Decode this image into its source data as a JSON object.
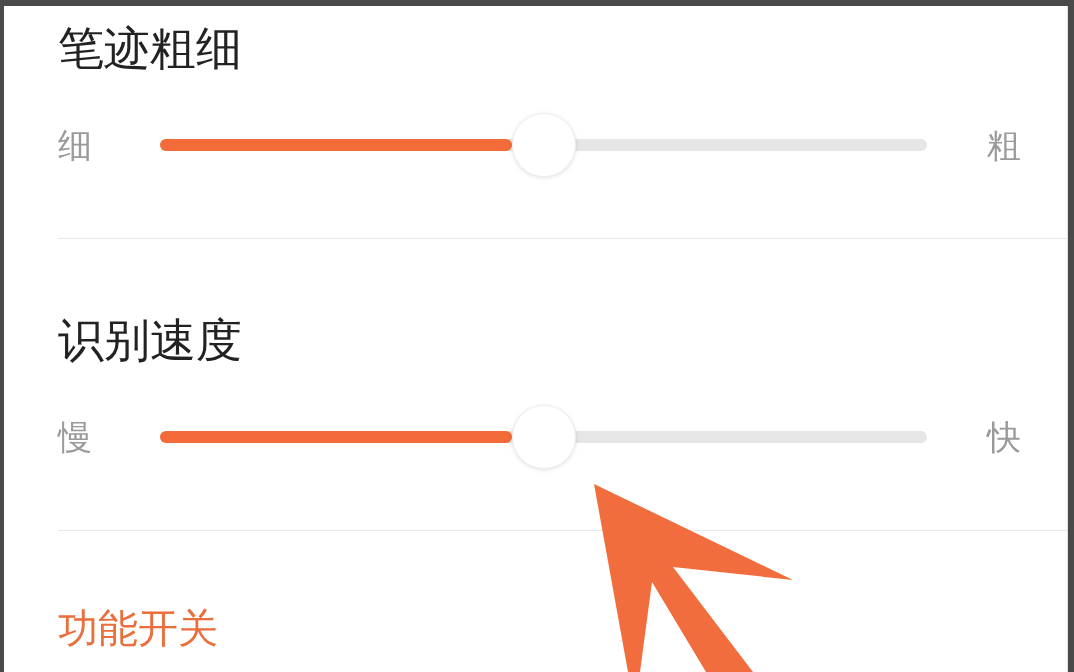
{
  "sections": [
    {
      "kind": "slider",
      "title": "笔迹粗细",
      "min_label": "细",
      "max_label": "粗",
      "level": 0.5
    },
    {
      "kind": "slider",
      "title": "识别速度",
      "min_label": "慢",
      "max_label": "快",
      "level": 0.5
    },
    {
      "kind": "header",
      "title": "功能开关"
    }
  ]
}
